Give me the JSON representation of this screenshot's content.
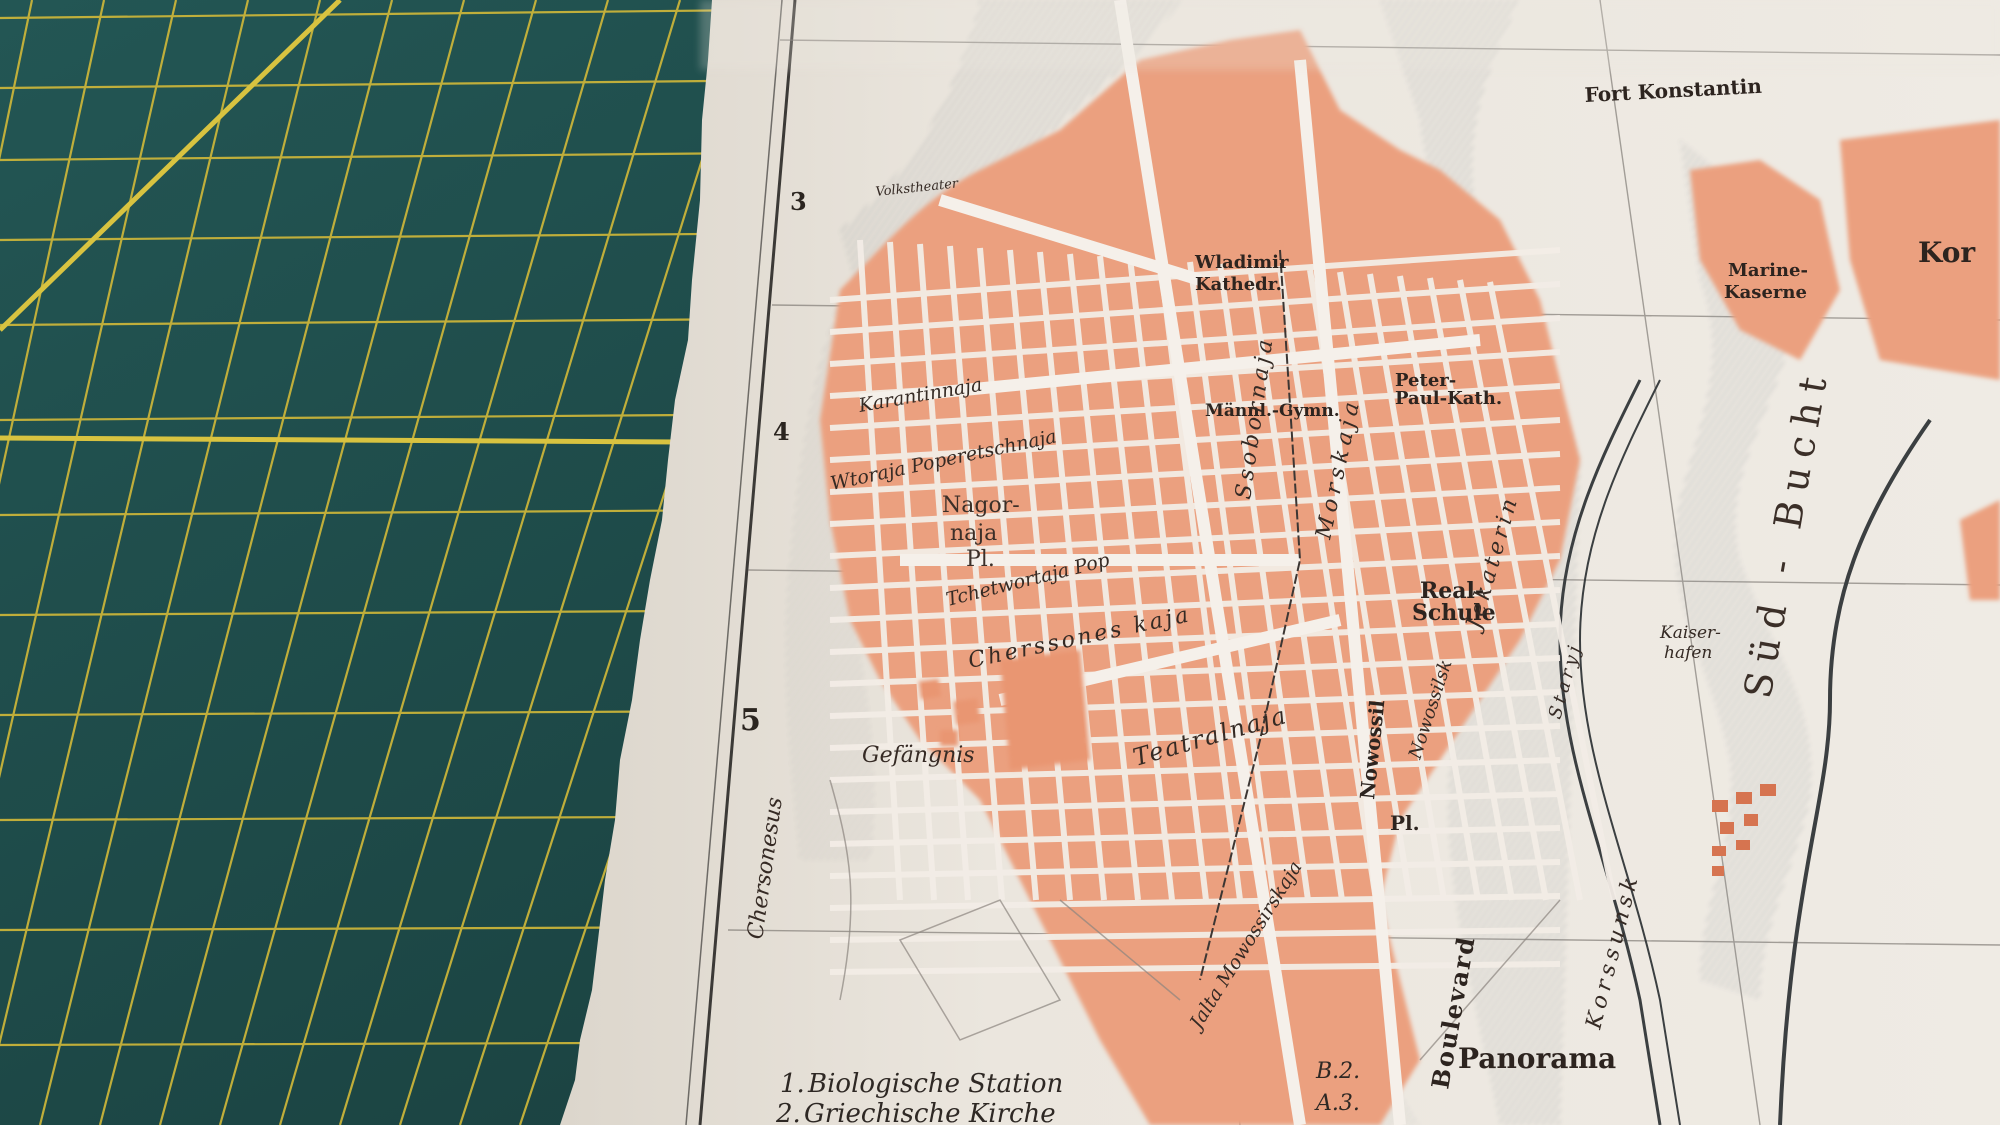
{
  "map": {
    "grid_numbers": [
      "3",
      "4",
      "5"
    ],
    "place_labels": {
      "vladimir": "Wladimir",
      "kathedr": "Kathedr.",
      "peter_paul_1": "Peter-",
      "peter_paul_2": "Paul-Kath.",
      "maenn_gymn": "Männl.-Gymn.",
      "real_schule_1": "Real-",
      "real_schule_2": "Schule",
      "nagornaja_1": "Nagor-",
      "nagornaja_2": "naja",
      "nagornaja_3": "Pl.",
      "nowossil_1": "Nowossil",
      "nowossil_2": "Pl.",
      "gefaengnis": "Gefängnis",
      "panorama": "Panorama",
      "kaiser_1": "Kaiser-",
      "kaiser_2": "hafen",
      "fort_konstantin": "Fort Konstantin",
      "marine_kaserne_1": "Marine-",
      "marine_kaserne_2": "Kaserne",
      "kom": "Kor",
      "volkstheater": "Volkstheater",
      "sued_bucht": "Süd - Bucht",
      "chersonesus": "Chersonesus"
    },
    "street_labels": {
      "karantinnaja": "Karantinnaja",
      "wtoraja_poperetschnaja": "Wtoraja Poperetschnaja",
      "tchetwortaja": "Tchetwortaja Pop",
      "chersssones": "Cherssones kaja",
      "teatralnaja": "Teatralnaja",
      "jekaterin": "Jekaterin",
      "morskaja": "Morskaja",
      "ssobornaja": "Ssobornaja",
      "jalta": "Jalta Mowossirskaja",
      "boulevard": "Boulevard",
      "korssunsk": "Korssunsk",
      "staryj": "Staryj",
      "nowossilsk": "Nowossilsk"
    },
    "legend": [
      {
        "num": "1.",
        "name": "Biologische Station",
        "ref": "B.2."
      },
      {
        "num": "2.",
        "name": "Griechische Kirche",
        "ref": "A.3."
      }
    ]
  },
  "colors": {
    "mat": "#1f4a48",
    "mat_grid": "#c9b43a",
    "paper": "#ece7df",
    "blocks": "#e89a78",
    "blocks_stroke": "#c8684a",
    "water_hatch": "#8a8f93",
    "ink": "#2d241f"
  }
}
